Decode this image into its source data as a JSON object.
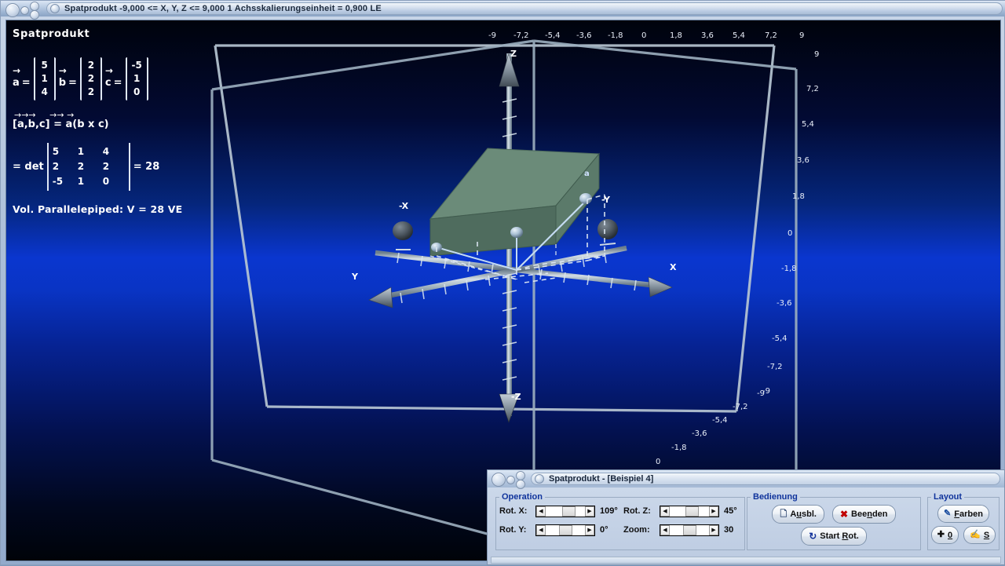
{
  "main_window": {
    "title_app": "Spatprodukt",
    "title_range": "-9,000 <= X, Y, Z <= 9,000",
    "title_scale": "1 Achsskalierungseinheit = 0,900 LE",
    "title_full": "Spatprodukt   -9,000 <= X, Y, Z <= 9,000   1 Achsskalierungseinheit = 0,900 LE"
  },
  "overlay": {
    "heading": "Spatprodukt",
    "vectors": [
      {
        "name": "a",
        "components": [
          "5",
          "1",
          "4"
        ]
      },
      {
        "name": "b",
        "components": [
          "2",
          "2",
          "2"
        ]
      },
      {
        "name": "c",
        "components": [
          "-5",
          "1",
          "0"
        ]
      }
    ],
    "triple_arrows_left": "→→→",
    "triple_arrows_right": "→→  →",
    "triple_formula": "[a,b,c] = a(b x c)",
    "det_label": "= det",
    "det_matrix": [
      [
        "5",
        "1",
        "4"
      ],
      [
        "2",
        "2",
        "2"
      ],
      [
        "-5",
        "1",
        "0"
      ]
    ],
    "det_result": "= 28",
    "volume_text": "Vol. Parallelepiped: V = 28 VE"
  },
  "axes": {
    "top_ticks": [
      "-9",
      "-7,2",
      "-5,4",
      "-3,6",
      "-1,8",
      "0",
      "1,8",
      "3,6",
      "5,4",
      "7,2",
      "9"
    ],
    "right_ticks": [
      "9",
      "7,2",
      "5,4",
      "3,6",
      "1,8",
      "0",
      "-1,8",
      "-3,6",
      "-5,4",
      "-7,2",
      "-9"
    ],
    "diag_ticks": [
      "-9",
      "-7,2",
      "-5,4",
      "-3,6",
      "-1,8",
      "0"
    ],
    "labels": {
      "z_pos": "Z",
      "z_neg": "-Z",
      "x_pos": "X",
      "x_neg": "-X",
      "y_pos": "Y",
      "y_neg": "-Y"
    },
    "vector_label_a": "a"
  },
  "dialog": {
    "title": "Spatprodukt - [Beispiel 4]",
    "operation": {
      "legend": "Operation",
      "sliders": [
        {
          "label": "Rot. X:",
          "value": "109°",
          "pos": 42
        },
        {
          "label": "Rot. Y:",
          "value": "0°",
          "pos": 34
        },
        {
          "label": "Rot. Z:",
          "value": "45°",
          "pos": 40
        },
        {
          "label": "Zoom:",
          "value": "30",
          "pos": 33
        }
      ]
    },
    "bedienung": {
      "legend": "Bedienung",
      "buttons": [
        {
          "name": "ausbl",
          "pre": "A",
          "mid": "u",
          "post": "sbl.",
          "icon": "document-icon"
        },
        {
          "name": "beenden",
          "pre": "Bee",
          "mid": "n",
          "post": "den",
          "icon": "close-x-icon"
        },
        {
          "name": "start-rot",
          "pre": "Start ",
          "mid": "R",
          "post": "ot.",
          "icon": "rotate-icon"
        }
      ]
    },
    "layout": {
      "legend": "Layout",
      "buttons": [
        {
          "name": "farben",
          "pre": "",
          "mid": "F",
          "post": "arben",
          "icon": "paint-icon"
        },
        {
          "name": "origin",
          "pre": "",
          "mid": "0",
          "post": "",
          "icon": "crosshair-icon"
        },
        {
          "name": "s",
          "pre": "",
          "mid": "S",
          "post": "",
          "icon": "brush-icon"
        }
      ]
    }
  },
  "colors": {
    "accent_blue": "#10349c",
    "solid_green": "#5e7d6e",
    "scene_bg_top": "#00040f",
    "scene_bg_mid": "#0a33c8",
    "axis_grey": "#9fb0bd"
  }
}
